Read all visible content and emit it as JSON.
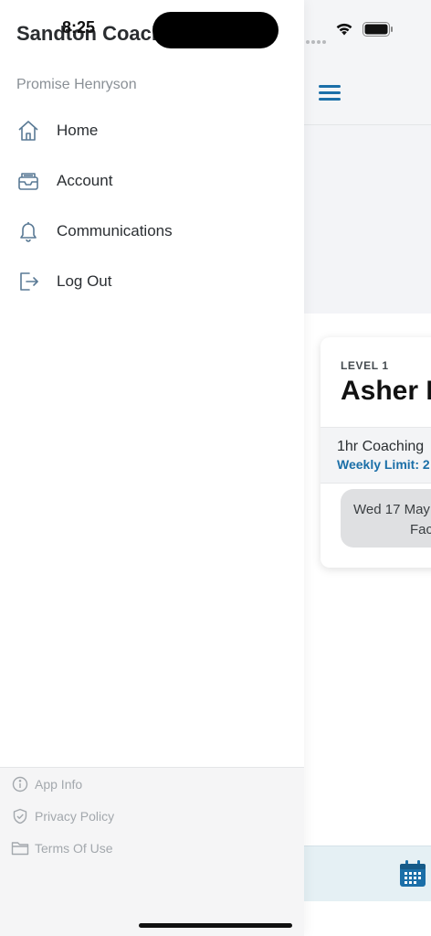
{
  "status_bar": {
    "time": "8:25"
  },
  "drawer": {
    "title": "Sandton Coaching Centre",
    "user_name": "Promise Henryson",
    "menu": [
      {
        "label": "Home",
        "icon": "home-icon"
      },
      {
        "label": "Account",
        "icon": "inbox-tray-icon"
      },
      {
        "label": "Communications",
        "icon": "bell-icon"
      },
      {
        "label": "Log Out",
        "icon": "logout-icon"
      }
    ],
    "footer": [
      {
        "label": "App Info",
        "icon": "info-icon"
      },
      {
        "label": "Privacy Policy",
        "icon": "shield-check-icon"
      },
      {
        "label": "Terms Of Use",
        "icon": "folder-icon"
      }
    ]
  },
  "background": {
    "card": {
      "level": "LEVEL 1",
      "name": "Asher I",
      "service": "1hr Coaching",
      "limit": "Weekly Limit: 2",
      "slot_date": "Wed 17 May",
      "slot_facility": "Fac"
    },
    "tab_icon": "calendar-icon"
  },
  "colors": {
    "accent": "#1b6fa8",
    "text_dark": "#2b2f33",
    "muted": "#8a9096",
    "footer_bg": "#f5f5f6",
    "tabbar_bg": "#e5f0f4"
  }
}
